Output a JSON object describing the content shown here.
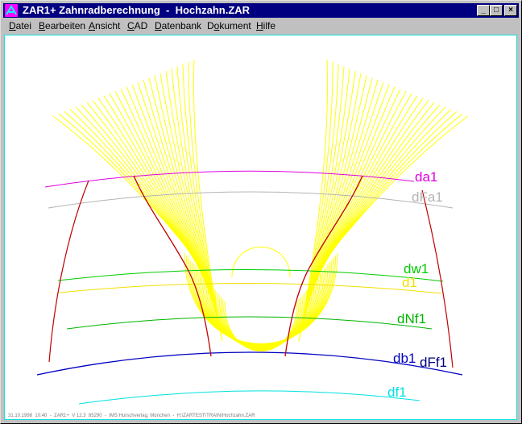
{
  "window": {
    "title": "ZAR1+ Zahnradberechnung  -  Hochzahn.ZAR",
    "controls": {
      "minimize": "_",
      "maximize": "□",
      "close": "×"
    }
  },
  "menu": [
    {
      "pre": "",
      "acc": "D",
      "post": "atei"
    },
    {
      "pre": "",
      "acc": "B",
      "post": "earbeiten"
    },
    {
      "pre": "",
      "acc": "A",
      "post": "nsicht"
    },
    {
      "pre": "",
      "acc": "C",
      "post": "AD"
    },
    {
      "pre": "",
      "acc": "D",
      "post": "atenbank"
    },
    {
      "pre": "D",
      "acc": "o",
      "post": "kument"
    },
    {
      "pre": "",
      "acc": "H",
      "post": "ilfe"
    }
  ],
  "drawing": {
    "labels": {
      "da1": "da1",
      "dFa1": "dFa1",
      "dw1": "dw1",
      "d1": "d1",
      "dNf1": "dNf1",
      "db1": "db1",
      "dFf1": "dFf1",
      "df1": "df1"
    },
    "colors": {
      "da1": "#e000e0",
      "dFa1": "#b4b4b4",
      "dw1": "#00cc00",
      "d1": "#f0e000",
      "dNf1": "#00b400",
      "db1": "#0000c0",
      "dFf1": "#000080",
      "df1": "#00e0e0",
      "flank": "#c00000",
      "envelope": "#ffff00"
    },
    "footer": "31.10.1998  10:40  -  ZAR1+  V 12.3  85290  -  IMS Hurschverlag, München  -  H:\\ZARTEST\\TRAIN\\Hochzahn.ZAR"
  }
}
